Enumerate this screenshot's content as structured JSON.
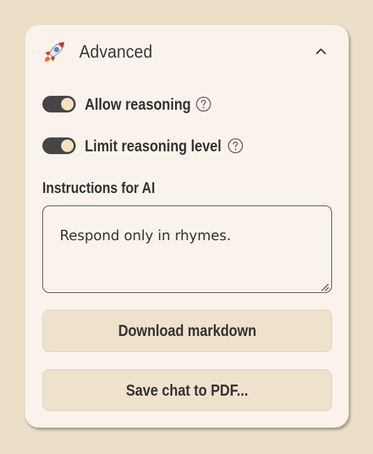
{
  "section": {
    "title": "Advanced",
    "icon": "rocket-icon",
    "expanded": true
  },
  "toggles": [
    {
      "label": "Allow reasoning",
      "on": true
    },
    {
      "label": "Limit reasoning level",
      "on": true
    }
  ],
  "instructions": {
    "label": "Instructions for AI",
    "value": "Respond only in rhymes."
  },
  "buttons": {
    "download_markdown": "Download markdown",
    "save_pdf": "Save chat to PDF..."
  },
  "colors": {
    "page_background": "#ecdfc7",
    "panel_background": "#faf3ec",
    "switch_track": "#454545",
    "switch_knob": "#f2e2c2",
    "button_background": "#efe2cd"
  }
}
